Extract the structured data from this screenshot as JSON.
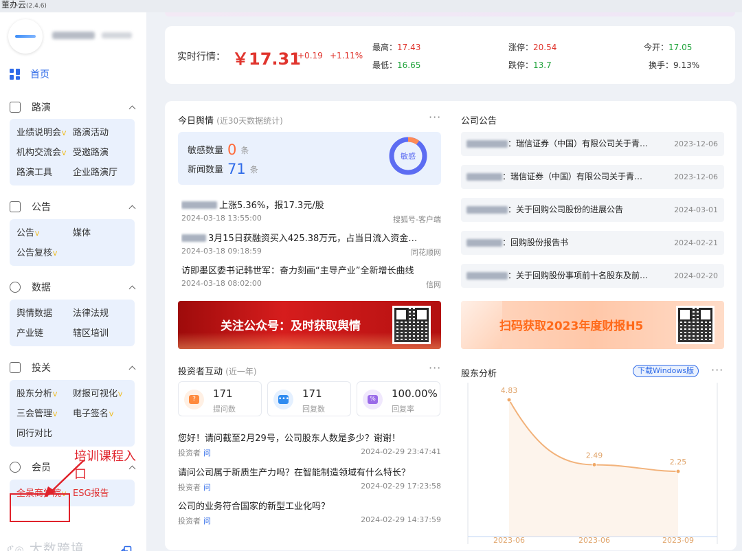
{
  "app": {
    "title": "董办云",
    "version": "(2.4.6)"
  },
  "sidebar": {
    "home_label": "首页",
    "sections": [
      {
        "title": "路演",
        "items": [
          {
            "label": "业绩说明会",
            "vip": true
          },
          {
            "label": "路演活动",
            "vip": false
          },
          {
            "label": "机构交流会",
            "vip": true
          },
          {
            "label": "受邀路演",
            "vip": false
          },
          {
            "label": "路演工具",
            "vip": false
          },
          {
            "label": "企业路演厅",
            "vip": false
          }
        ]
      },
      {
        "title": "公告",
        "items": [
          {
            "label": "公告",
            "vip": true
          },
          {
            "label": "媒体",
            "vip": false
          },
          {
            "label": "公告复核",
            "vip": true
          }
        ]
      },
      {
        "title": "数据",
        "items": [
          {
            "label": "舆情数据",
            "vip": false
          },
          {
            "label": "法律法规",
            "vip": false
          },
          {
            "label": "产业链",
            "vip": false
          },
          {
            "label": "辖区培训",
            "vip": false
          }
        ]
      },
      {
        "title": "投关",
        "items": [
          {
            "label": "股东分析",
            "vip": true
          },
          {
            "label": "财报可视化",
            "vip": true
          },
          {
            "label": "三会管理",
            "vip": true
          },
          {
            "label": "电子签名",
            "vip": true
          },
          {
            "label": "同行对比",
            "vip": false
          }
        ]
      },
      {
        "title": "会员",
        "items": [
          {
            "label": "全景商学院",
            "vip": true
          },
          {
            "label": "ESG报告",
            "vip": false
          }
        ]
      }
    ],
    "vip_mark": "V",
    "annotation": "培训课程入口",
    "watermark": "大数跨境"
  },
  "quote": {
    "label": "实时行情：",
    "price": "￥17.31",
    "change": "+0.19",
    "change_pct": "+1.11%",
    "high_label": "最高：",
    "high": "17.43",
    "low_label": "最低：",
    "low": "16.65",
    "limit_up_label": "涨停：",
    "limit_up": "20.54",
    "limit_down_label": "跌停：",
    "limit_down": "13.7",
    "open_label": "今开：",
    "open": "17.05",
    "turnover_label": "换手：",
    "turnover": "9.13%"
  },
  "sentiment": {
    "title": "今日舆情",
    "subtitle": "(近30天数据统计)",
    "sensitive_label": "敏感数量",
    "sensitive_value": "0",
    "news_label": "新闻数量",
    "news_value": "71",
    "unit": "条",
    "donut_label": "敏感",
    "donut_fraction": 0.1,
    "news": [
      {
        "title": "上涨5.36%，报17.3元/股",
        "date": "2024-03-18 13:55:00",
        "source": "搜狐号-客户端",
        "redacted": true
      },
      {
        "title": "3月15日获融资买入425.38万元，占当日流入资金…",
        "date": "2024-03-18 09:18:59",
        "source": "同花顺网",
        "redacted": true
      },
      {
        "title": "访即墨区委书记韩世军：奋力刻画“主导产业”全新增长曲线",
        "date": "2024-03-18 08:02:00",
        "source": "信网",
        "redacted": false
      }
    ],
    "banner_text": "关注公众号：及时获取舆情"
  },
  "investor": {
    "title": "投资者互动",
    "subtitle": "(近一年)",
    "stats": [
      {
        "value": "171",
        "label": "提问数",
        "icon": "question-icon",
        "color": "#ff8a3d",
        "bg": "#fff0e4",
        "glyph": "?"
      },
      {
        "value": "171",
        "label": "回复数",
        "icon": "reply-icon",
        "color": "#2f8bf0",
        "bg": "#e4f0ff",
        "glyph": "•••"
      },
      {
        "value": "100.00%",
        "label": "回复率",
        "icon": "percent-icon",
        "color": "#9a6ae8",
        "bg": "#f0e8fd",
        "glyph": "%"
      }
    ],
    "asker_label": "投资者",
    "ask_label": "问",
    "qa": [
      {
        "q": "您好！请问截至2月29号，公司股东人数是多少？谢谢！",
        "date": "2024-02-29 23:47:41"
      },
      {
        "q": "请问公司属于新质生产力吗？在智能制造领域有什么特长？",
        "date": "2024-02-29 17:23:58"
      },
      {
        "q": "公司的业务符合国家的新型工业化吗？",
        "date": "2024-02-29 14:37:59"
      }
    ]
  },
  "notices": {
    "title": "公司公告",
    "items": [
      {
        "text": "：瑞信证券（中国）有限公司关于青…",
        "date": "2023-12-06"
      },
      {
        "text": "：瑞信证券（中国）有限公司关于青…",
        "date": "2023-12-06"
      },
      {
        "text": "：关于回购公司股份的进展公告",
        "date": "2024-03-01"
      },
      {
        "text": "：回购股份报告书",
        "date": "2024-02-21"
      },
      {
        "text": "：关于回购股份事项前十名股东及前…",
        "date": "2024-02-20"
      }
    ],
    "banner_text": "扫码获取2023年度财报H5"
  },
  "shareholder": {
    "title": "股东分析",
    "download_label": "下载Windows版",
    "line_color": "#f2b27a"
  },
  "chart_data": {
    "type": "area",
    "categories": [
      "2023-06",
      "2023-06",
      "2023-09"
    ],
    "values": [
      4.83,
      2.49,
      2.25
    ],
    "title": "",
    "xlabel": "",
    "ylabel": "",
    "ylim": [
      0,
      5.2
    ],
    "grid": false
  }
}
